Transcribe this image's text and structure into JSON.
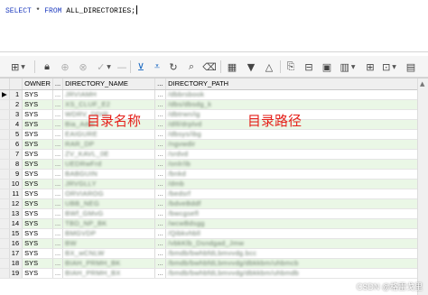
{
  "editor": {
    "sql_kw1": "SELECT",
    "sql_star": " * ",
    "sql_kw2": "FROM",
    "sql_rest": " ALL_DIRECTORIES;"
  },
  "toolbar": {
    "icons": [
      "grid-layout-icon",
      "lock-icon",
      "add-row-icon",
      "delete-row-icon",
      "post-changes-icon",
      "cancel-changes-icon",
      "fetch-next-icon",
      "fetch-all-icon",
      "refresh-icon",
      "search-icon",
      "clear-icon",
      "grid-view-icon",
      "sort-desc-icon",
      "sort-asc-icon",
      "export-icon",
      "query-by-example-icon",
      "single-record-icon",
      "chart-icon",
      "layout-icon",
      "freeze-icon",
      "table-icon"
    ]
  },
  "grid": {
    "columns": [
      "",
      "OWNER",
      "...",
      "DIRECTORY_NAME",
      "...",
      "DIRECTORY_PATH"
    ],
    "more_glyph": "...",
    "rows": [
      {
        "n": "1",
        "owner": "SYS",
        "name": "JRVIAMH",
        "path": "/dbbrsbook"
      },
      {
        "n": "2",
        "owner": "SYS",
        "name": "XS_CLUF_E2",
        "path": "/dbs/dbsdg_k"
      },
      {
        "n": "3",
        "owner": "SYS",
        "name": "WDRV_DDIR",
        "path": "/dbtrwn/ig"
      },
      {
        "n": "4",
        "owner": "SYS",
        "name": "Bia_Addr",
        "path": "/dlll/drplvd"
      },
      {
        "n": "5",
        "owner": "SYS",
        "name": "EAIGURE",
        "path": "/dbsys/ibg"
      },
      {
        "n": "6",
        "owner": "SYS",
        "name": "RAR_DP",
        "path": "/ngvwdir"
      },
      {
        "n": "7",
        "owner": "SYS",
        "name": "ZV_KAVL_0E",
        "path": "/srdvd"
      },
      {
        "n": "8",
        "owner": "SYS",
        "name": "UEDRwFrd",
        "path": "/onlr/ib"
      },
      {
        "n": "9",
        "owner": "SYS",
        "name": "BABGUIN",
        "path": "/bnkd"
      },
      {
        "n": "10",
        "owner": "SYS",
        "name": "JRVGLLY",
        "path": "/dmb"
      },
      {
        "n": "11",
        "owner": "SYS",
        "name": "ORVIAROG",
        "path": "/bedsrf"
      },
      {
        "n": "12",
        "owner": "SYS",
        "name": "UBB_NEG",
        "path": "/bdveBddf"
      },
      {
        "n": "13",
        "owner": "SYS",
        "name": "BWf_GMvG",
        "path": "/bwcgsefl"
      },
      {
        "n": "14",
        "owner": "SYS",
        "name": "TBD_NP_BK",
        "path": "/wcwBdsgg"
      },
      {
        "n": "15",
        "owner": "SYS",
        "name": "BMGVDP",
        "path": "/Qibkvhbll"
      },
      {
        "n": "16",
        "owner": "SYS",
        "name": "BW",
        "path": "/vbkKlb_Dsndgad_Jmw"
      },
      {
        "n": "17",
        "owner": "SYS",
        "name": "BX_wCNLW",
        "path": "/bmdb/bwhbfdLbmvvdg.bcc"
      },
      {
        "n": "18",
        "owner": "SYS",
        "name": "BIAH_PRMH_BK",
        "path": "/bmdb/bwhbfdLbmvvdg/dbkkbm/uhbmcb"
      },
      {
        "n": "19",
        "owner": "SYS",
        "name": "BIAH_PRMH_BX",
        "path": "/bmdb/bwhbfdLbmvvdg/dbkkbm/uhbmdb"
      }
    ]
  },
  "annotations": {
    "name_label": "目录名称",
    "path_label": "目录路径"
  },
  "watermark": "CSDN @格雷戈里"
}
